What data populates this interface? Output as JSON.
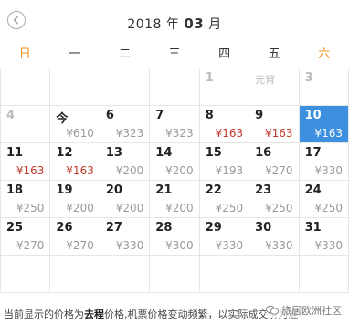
{
  "header": {
    "year_label": "2018 年",
    "month": "03",
    "month_suffix": "月"
  },
  "weekdays": [
    "日",
    "一",
    "二",
    "三",
    "四",
    "五",
    "六"
  ],
  "rows": [
    [
      {
        "day": "",
        "price": ""
      },
      {
        "day": "",
        "price": ""
      },
      {
        "day": "",
        "price": ""
      },
      {
        "day": "",
        "price": ""
      },
      {
        "day": "1",
        "price": "",
        "style": "gray"
      },
      {
        "day": "元宵",
        "price": "",
        "style": "holiday"
      },
      {
        "day": "3",
        "price": "",
        "style": "gray"
      }
    ],
    [
      {
        "day": "4",
        "price": "",
        "style": "gray"
      },
      {
        "day": "今",
        "price": "¥610"
      },
      {
        "day": "6",
        "price": "¥323"
      },
      {
        "day": "7",
        "price": "¥323"
      },
      {
        "day": "8",
        "price": "¥163",
        "low": true
      },
      {
        "day": "9",
        "price": "¥163",
        "low": true
      },
      {
        "day": "10",
        "price": "¥163",
        "selected": true
      }
    ],
    [
      {
        "day": "11",
        "price": "¥163",
        "low": true
      },
      {
        "day": "12",
        "price": "¥163",
        "low": true
      },
      {
        "day": "13",
        "price": "¥200"
      },
      {
        "day": "14",
        "price": "¥200"
      },
      {
        "day": "15",
        "price": "¥193"
      },
      {
        "day": "16",
        "price": "¥270"
      },
      {
        "day": "17",
        "price": "¥330"
      }
    ],
    [
      {
        "day": "18",
        "price": "¥250"
      },
      {
        "day": "19",
        "price": "¥200"
      },
      {
        "day": "20",
        "price": "¥200"
      },
      {
        "day": "21",
        "price": "¥200"
      },
      {
        "day": "22",
        "price": "¥250"
      },
      {
        "day": "23",
        "price": "¥250"
      },
      {
        "day": "24",
        "price": "¥250"
      }
    ],
    [
      {
        "day": "25",
        "price": "¥270"
      },
      {
        "day": "26",
        "price": "¥270"
      },
      {
        "day": "27",
        "price": "¥330"
      },
      {
        "day": "28",
        "price": "¥300"
      },
      {
        "day": "29",
        "price": "¥330"
      },
      {
        "day": "30",
        "price": "¥330"
      },
      {
        "day": "31",
        "price": "¥330"
      }
    ],
    [
      {
        "day": "",
        "price": ""
      },
      {
        "day": "",
        "price": ""
      },
      {
        "day": "",
        "price": ""
      },
      {
        "day": "",
        "price": ""
      },
      {
        "day": "",
        "price": ""
      },
      {
        "day": "",
        "price": ""
      },
      {
        "day": "",
        "price": ""
      }
    ]
  ],
  "notice": {
    "prefix": "当前显示的价格为",
    "bold": "去程",
    "suffix": "价格,机票价格变动频繁，以实际成交价为准"
  },
  "watermark": "旅居欧洲社区",
  "colors": {
    "selected": "#3d8fe0",
    "low_price": "#c0392b",
    "weekend": "#f0901e"
  }
}
